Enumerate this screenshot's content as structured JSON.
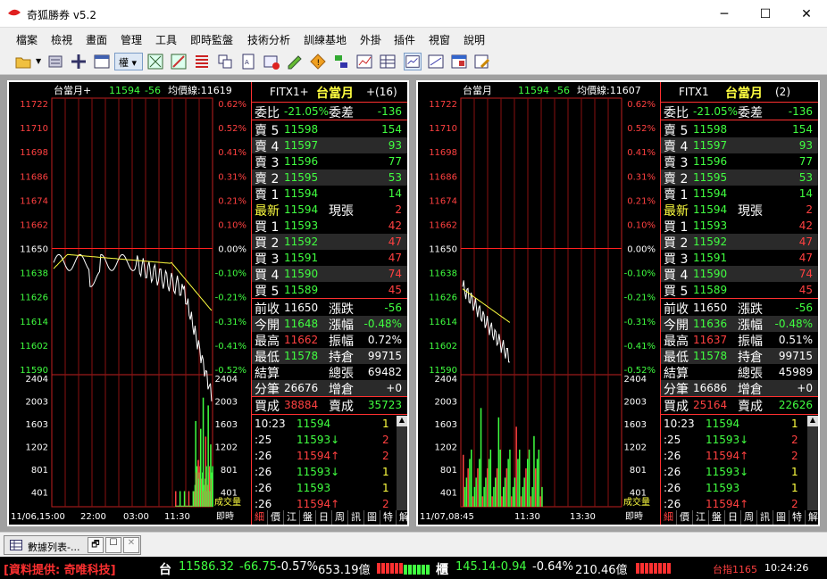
{
  "app": {
    "title": "奇狐勝券 v5.2"
  },
  "menu": [
    "檔案",
    "檢視",
    "畫面",
    "管理",
    "工具",
    "即時監盤",
    "技術分析",
    "訓練基地",
    "外掛",
    "插件",
    "視窗",
    "說明"
  ],
  "toolbar": {
    "sel_label": "權"
  },
  "left": {
    "header": {
      "name": "台當月+",
      "price": "11594",
      "chg": "-56",
      "avg_label": "均價線:11619"
    },
    "yprices": [
      "11722",
      "11710",
      "11698",
      "11686",
      "11674",
      "11662",
      "11650",
      "11638",
      "11626",
      "11614",
      "11602",
      "11590"
    ],
    "ypcts": [
      "0.62%",
      "0.52%",
      "0.41%",
      "0.31%",
      "0.21%",
      "0.10%",
      "0.00%",
      "-0.10%",
      "-0.21%",
      "-0.31%",
      "-0.41%",
      "-0.52%"
    ],
    "yvol": [
      "2404",
      "2003",
      "1603",
      "1202",
      "801",
      "401"
    ],
    "vol_label": "成交量",
    "xlabels": [
      "11/06,15:00",
      "22:00",
      "03:00",
      "11:30"
    ],
    "xlabel_right": "即時",
    "q": {
      "sym": "FITX1+",
      "name": "台當月",
      "cnt": "+(16)",
      "r0": [
        "委比",
        "-21.05%",
        "委差",
        "-136"
      ],
      "asks": [
        [
          "賣 5",
          "11598",
          "154"
        ],
        [
          "賣 4",
          "11597",
          "93"
        ],
        [
          "賣 3",
          "11596",
          "77"
        ],
        [
          "賣 2",
          "11595",
          "53"
        ],
        [
          "賣 1",
          "11594",
          "14"
        ]
      ],
      "last": [
        "最新",
        "11594",
        "現張",
        "2"
      ],
      "bids": [
        [
          "買 1",
          "11593",
          "42"
        ],
        [
          "買 2",
          "11592",
          "47"
        ],
        [
          "買 3",
          "11591",
          "47"
        ],
        [
          "買 4",
          "11590",
          "74"
        ],
        [
          "買 5",
          "11589",
          "45"
        ]
      ],
      "s1": [
        "前收",
        "11650",
        "漲跌",
        "-56"
      ],
      "s2": [
        "今開",
        "11648",
        "漲幅",
        "-0.48%"
      ],
      "s3": [
        "最高",
        "11662",
        "振幅",
        "0.72%"
      ],
      "s4": [
        "最低",
        "11578",
        "持倉",
        "99715"
      ],
      "s5": [
        "結算",
        "",
        "總張",
        "69482"
      ],
      "s6": [
        "分筆",
        "26676",
        "增倉",
        "+0"
      ],
      "s7": [
        "買成",
        "38884",
        "賣成",
        "35723"
      ],
      "ticks": [
        [
          "10:23",
          "11594",
          "1"
        ],
        [
          ":25",
          "11593↓",
          "2"
        ],
        [
          ":26",
          "11594↑",
          "2"
        ],
        [
          ":26",
          "11593↓",
          "1"
        ],
        [
          ":26",
          "11593",
          "1"
        ],
        [
          ":26",
          "11594↑",
          "2"
        ]
      ],
      "tabs": [
        "細",
        "價",
        "江",
        "盤",
        "日",
        "周",
        "訊",
        "圖",
        "特",
        "解"
      ]
    }
  },
  "right": {
    "header": {
      "name": "台當月",
      "price": "11594",
      "chg": "-56",
      "avg_label": "均價線:11607"
    },
    "xlabels": [
      "11/07,08:45",
      "11:30",
      "13:30"
    ],
    "xlabel_right": "即時",
    "q": {
      "sym": "FITX1",
      "name": "台當月",
      "cnt": "(2)",
      "r0": [
        "委比",
        "-21.05%",
        "委差",
        "-136"
      ],
      "asks": [
        [
          "賣 5",
          "11598",
          "154"
        ],
        [
          "賣 4",
          "11597",
          "93"
        ],
        [
          "賣 3",
          "11596",
          "77"
        ],
        [
          "賣 2",
          "11595",
          "53"
        ],
        [
          "賣 1",
          "11594",
          "14"
        ]
      ],
      "last": [
        "最新",
        "11594",
        "現張",
        "2"
      ],
      "bids": [
        [
          "買 1",
          "11593",
          "42"
        ],
        [
          "買 2",
          "11592",
          "47"
        ],
        [
          "買 3",
          "11591",
          "47"
        ],
        [
          "買 4",
          "11590",
          "74"
        ],
        [
          "買 5",
          "11589",
          "45"
        ]
      ],
      "s1": [
        "前收",
        "11650",
        "漲跌",
        "-56"
      ],
      "s2": [
        "今開",
        "11636",
        "漲幅",
        "-0.48%"
      ],
      "s3": [
        "最高",
        "11637",
        "振幅",
        "0.51%"
      ],
      "s4": [
        "最低",
        "11578",
        "持倉",
        "99715"
      ],
      "s5": [
        "結算",
        "",
        "總張",
        "45989"
      ],
      "s6": [
        "分筆",
        "16686",
        "增倉",
        "+0"
      ],
      "s7": [
        "買成",
        "25164",
        "賣成",
        "22626"
      ],
      "ticks": [
        [
          "10:23",
          "11594",
          "1"
        ],
        [
          ":25",
          "11593↓",
          "2"
        ],
        [
          ":26",
          "11594↑",
          "2"
        ],
        [
          ":26",
          "11593↓",
          "1"
        ],
        [
          ":26",
          "11593",
          "1"
        ],
        [
          ":26",
          "11594↑",
          "2"
        ]
      ],
      "tabs": [
        "細",
        "價",
        "江",
        "盤",
        "日",
        "周",
        "訊",
        "圖",
        "特",
        "解"
      ]
    }
  },
  "taskbar": {
    "tab": "數據列表-..."
  },
  "status": {
    "provider": "[資料提供: 奇唯科技]",
    "t1": "台",
    "v1": "11586.32",
    "c1": "-66.75",
    "p1": "-0.57%",
    "a1": "653.19億",
    "t2": "櫃",
    "v2": "145.14",
    "c2": "-0.94",
    "p2": "-0.64%",
    "a2": "210.46億",
    "idx": "台指1165",
    "time": "10:24:26"
  }
}
